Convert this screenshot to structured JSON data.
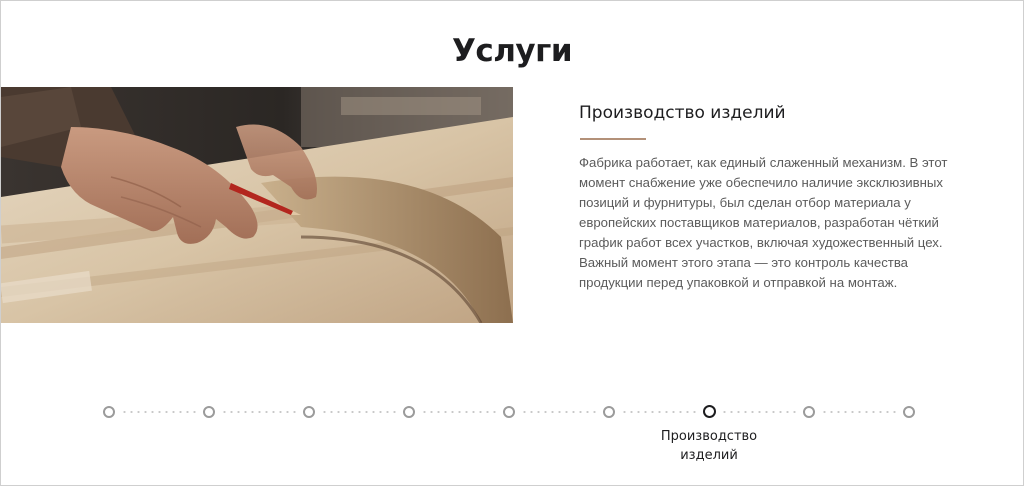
{
  "page": {
    "title": "Услуги"
  },
  "service": {
    "title": "Производство изделий",
    "description": "Фабрика работает, как единый слаженный механизм. В этот момент снабжение уже обеспечило наличие эксклюзивных позиций и фурнитуры, был сделан отбор материала у европейских поставщиков материалов, разработан чёткий график работ всех участков, включая художественный цех. Важный момент этого этапа — это контроль качества продукции перед упаковкой и отправкой на монтаж.",
    "image": {
      "icon": "craftsman-marking-wood-photo"
    },
    "accent_color": "#b39179"
  },
  "timeline": {
    "step_count": 9,
    "active_index": 6,
    "active_label": "Производство изделий"
  }
}
